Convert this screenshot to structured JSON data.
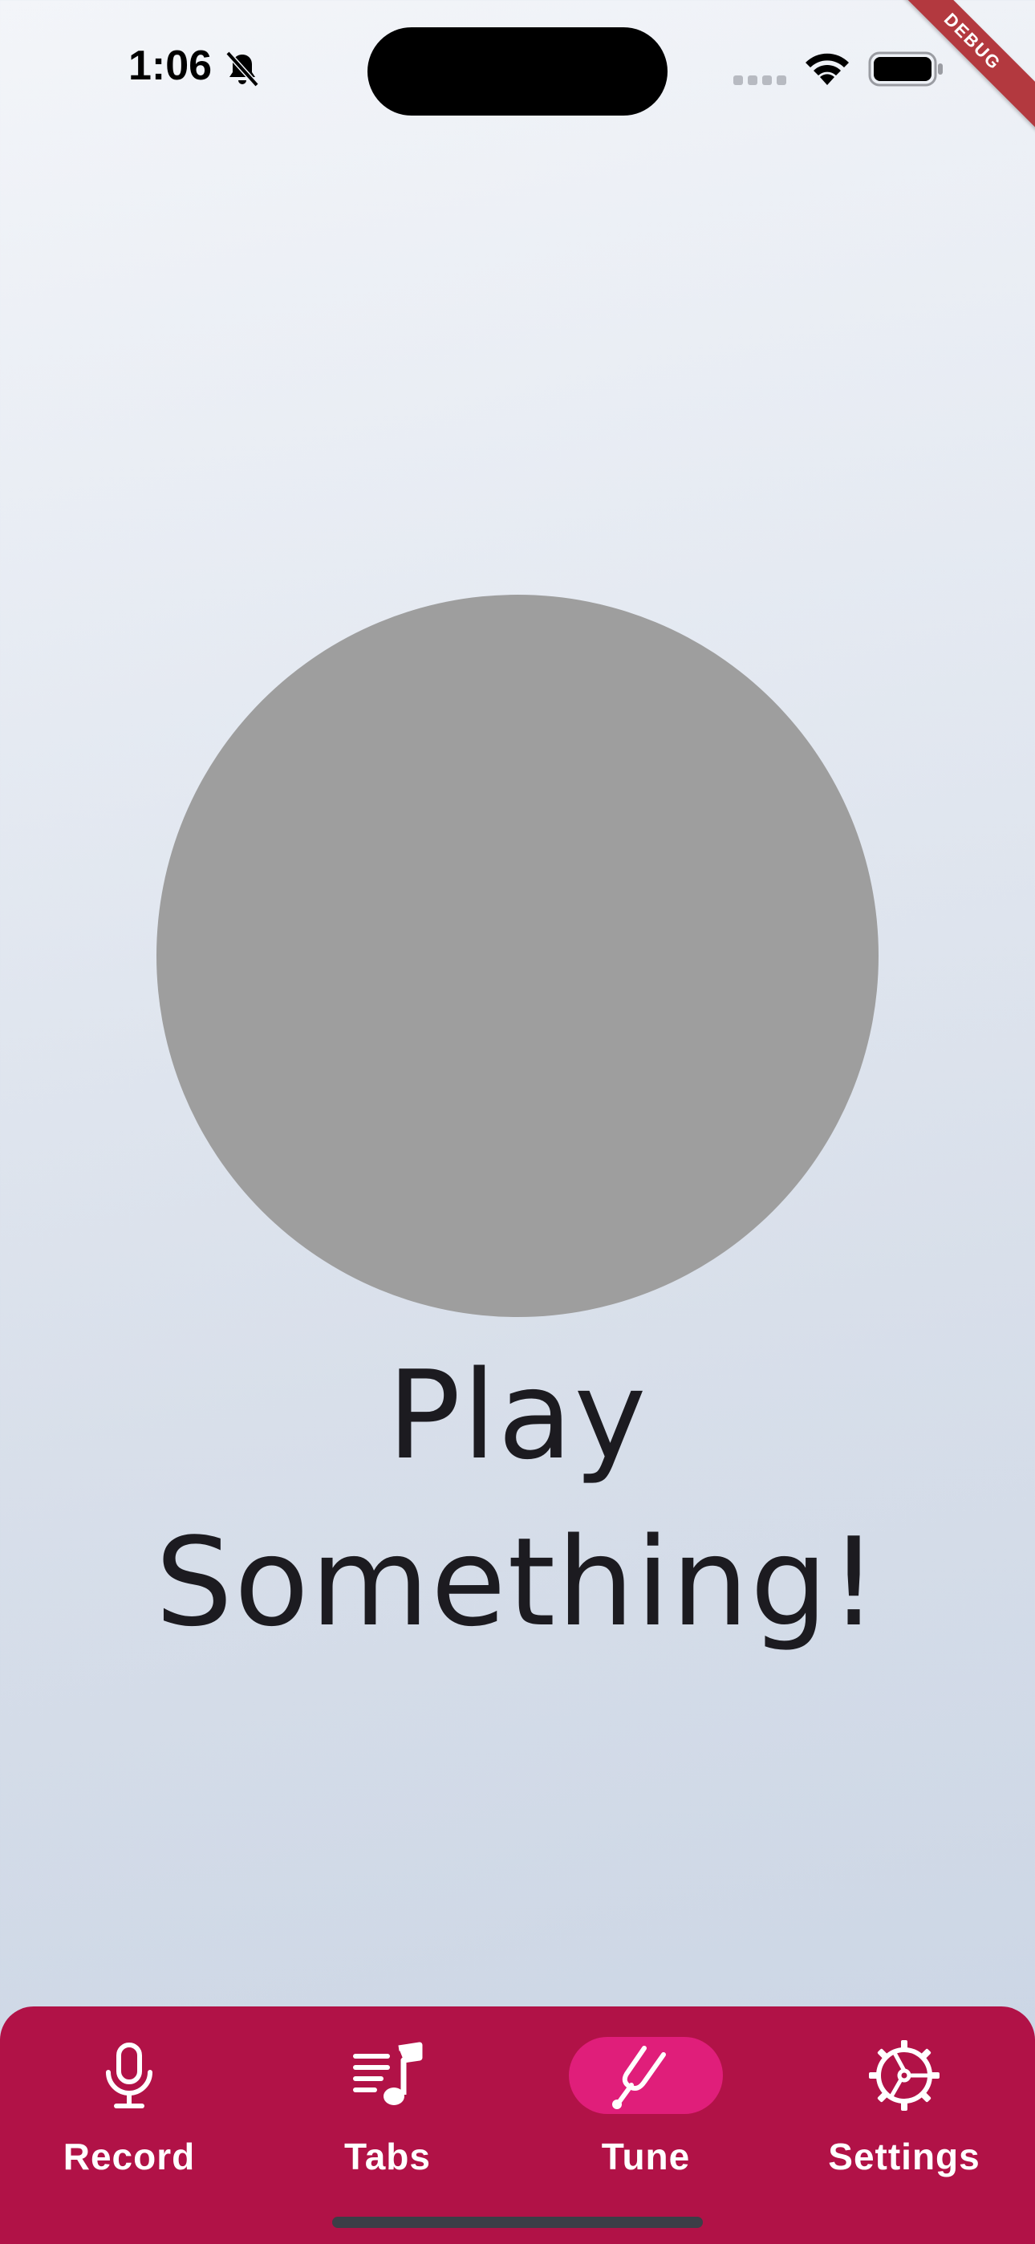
{
  "status_bar": {
    "time": "1:06"
  },
  "debug_banner": "DEBUG",
  "tuner": {
    "prompt_line1": "Play",
    "prompt_line2": "Something!",
    "circle_color": "#9e9e9e"
  },
  "nav": {
    "background_color": "#b11247",
    "active_indicator_color": "#e01e7a",
    "items": [
      {
        "label": "Record",
        "icon": "microphone-icon",
        "active": false
      },
      {
        "label": "Tabs",
        "icon": "music-list-icon",
        "active": false
      },
      {
        "label": "Tune",
        "icon": "tuning-fork-icon",
        "active": true
      },
      {
        "label": "Settings",
        "icon": "gear-icon",
        "active": false
      }
    ]
  }
}
